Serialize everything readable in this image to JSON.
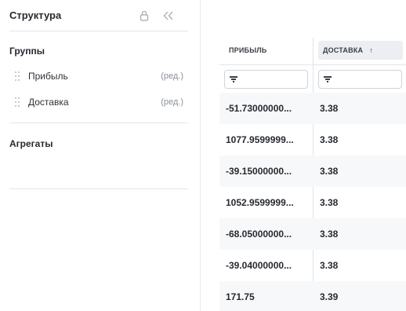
{
  "panel": {
    "title": "Структура",
    "groups_title": "Группы",
    "groups": [
      {
        "label": "Прибыль",
        "edit": "(ред.)"
      },
      {
        "label": "Доставка",
        "edit": "(ред.)"
      }
    ],
    "aggregates_title": "Агрегаты",
    "icons": [
      "lock-icon",
      "double-chevron-left-icon",
      "drag-handle-icon"
    ]
  },
  "table": {
    "columns": [
      "ПРИБЫЛЬ",
      "ДОСТАВКА"
    ],
    "sort": {
      "column": "ДОСТАВКА",
      "direction": "asc",
      "icon": "↑"
    },
    "rows": [
      [
        "-51.73000000...",
        "3.38"
      ],
      [
        "1077.9599999...",
        "3.38"
      ],
      [
        "-39.15000000...",
        "3.38"
      ],
      [
        "1052.9599999...",
        "3.38"
      ],
      [
        "-68.05000000...",
        "3.38"
      ],
      [
        "-39.04000000...",
        "3.38"
      ],
      [
        "171.75",
        "3.39"
      ]
    ]
  }
}
